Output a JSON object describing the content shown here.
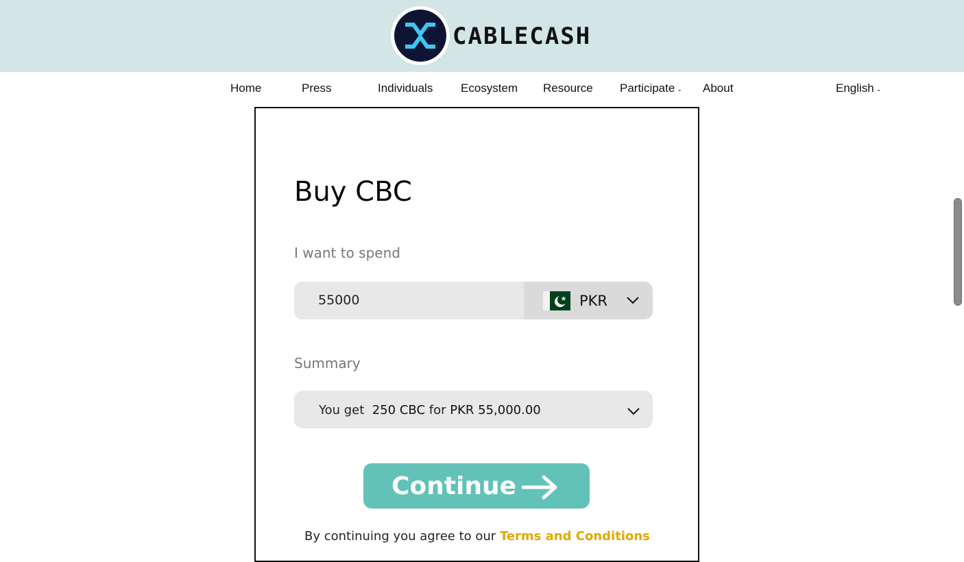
{
  "header": {
    "brand": "CABLECASH",
    "logo_icon": "cablecash-x-logo-icon",
    "colors": {
      "topbar": "#d3e5e5",
      "logo_bg": "#0e1433",
      "logo_mark": "#3fc6f0"
    }
  },
  "nav": {
    "items": [
      "Home",
      "Press",
      "Individuals",
      "Ecosystem",
      "Resource",
      "Participate",
      "About"
    ],
    "language": "English"
  },
  "form": {
    "title": "Buy CBC",
    "spend_label": "I want to spend",
    "amount": "55000",
    "currency": "PKR",
    "currency_icon": "pakistan-flag-icon",
    "summary_label": "Summary",
    "summary": {
      "prefix": "You get",
      "amount": "250 CBC",
      "middle": "for",
      "total": "PKR 55,000.00"
    },
    "continue_label": "Continue",
    "terms_prefix": "By continuing you agree to our",
    "terms_link": "Terms and Conditions",
    "colors": {
      "continue": "#62c2b8",
      "terms_link": "#e0a800"
    }
  }
}
